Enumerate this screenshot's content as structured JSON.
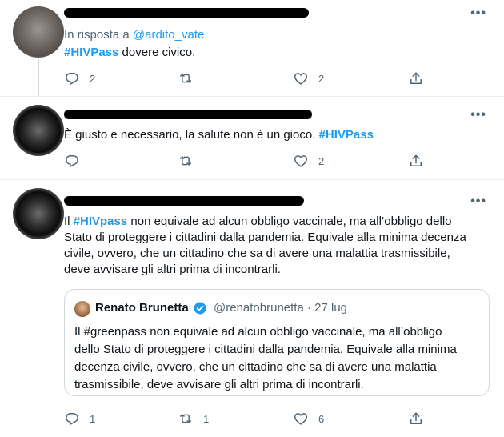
{
  "tweets": [
    {
      "reply_prefix": "In risposta a ",
      "reply_handle": "@ardito_vate",
      "hashtag": "#HIVPass",
      "text_after": " dovere civico.",
      "replies": "2",
      "retweets": "",
      "likes": "2"
    },
    {
      "text_before": "È giusto e necessario, la salute non è un gioco. ",
      "hashtag": "#HIVPass",
      "replies": "",
      "retweets": "",
      "likes": "2"
    },
    {
      "text_before": "Il ",
      "hashtag": "#HIVpass",
      "lines": [
        " non equivale ad alcun obbligo vaccinale, ma all’obbligo dello",
        "Stato di proteggere i cittadini dalla pandemia. Equivale alla minima decenza",
        "civile, ovvero, che un cittadino che sa di avere una malattia trasmissibile,",
        "deve avvisare gli altri prima di incontrarli."
      ],
      "replies": "1",
      "retweets": "1",
      "likes": "6",
      "quote": {
        "name": "Renato Brunetta",
        "handle_date": "@renatobrunetta · 27 lug",
        "lines": [
          "Il #greenpass non equivale ad alcun obbligo vaccinale, ma all’obbligo",
          "dello Stato di proteggere i cittadini dalla pandemia. Equivale alla minima",
          "decenza civile, ovvero, che un cittadino che sa di avere una malattia",
          "trasmissibile, deve avvisare gli altri prima di incontrarli."
        ]
      }
    }
  ],
  "more_label": "•••",
  "colors": {
    "accent": "#1d9bf0",
    "muted": "#536471",
    "text": "#0f1419",
    "border": "#cfd9de"
  }
}
